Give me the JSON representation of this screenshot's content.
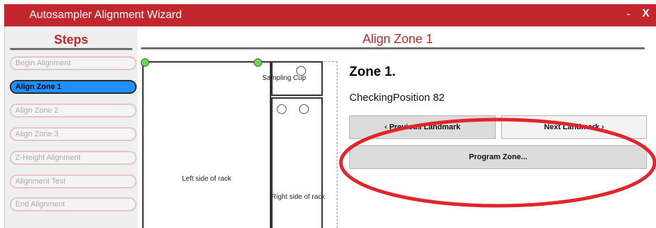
{
  "window": {
    "title": "Autosampler Alignment Wizard",
    "minimize_label": "-",
    "close_label": "X"
  },
  "steps": {
    "header": "Steps",
    "items": [
      {
        "label": "Begin Alignment",
        "active": false
      },
      {
        "label": "Align Zone 1",
        "active": true
      },
      {
        "label": "Align Zone 2",
        "active": false
      },
      {
        "label": "Align Zone 3",
        "active": false
      },
      {
        "label": "Z-Height Alignment",
        "active": false
      },
      {
        "label": "Alignment Test",
        "active": false
      },
      {
        "label": "End Alignment",
        "active": false
      }
    ]
  },
  "main": {
    "header": "Align Zone 1",
    "zone_title": "Zone 1.",
    "checking_position": "CheckingPosition 82",
    "previous_landmark": "Previous Landmark",
    "next_landmark": "Next Landmark",
    "program_zone": "Program Zone..."
  },
  "rack": {
    "sampling_cup": "Sampling Cup",
    "left_side": "Left side of rack",
    "right_side": "Right side of rack"
  },
  "colors": {
    "title_bar": "#c1272d",
    "active_step": "#1e90ff",
    "annotation_ellipse": "#e0262b"
  }
}
